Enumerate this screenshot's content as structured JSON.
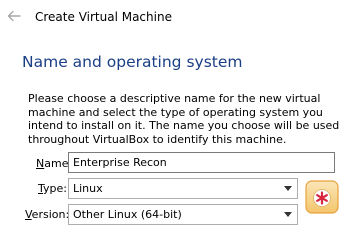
{
  "window": {
    "title": "Create Virtual Machine",
    "back_icon": "back-arrow-icon"
  },
  "page": {
    "heading": "Name and operating system",
    "description": "Please choose a descriptive name for the new virtual machine and select the type of operating system you intend to install on it. The name you choose will be used throughout VirtualBox to identify this machine."
  },
  "form": {
    "name": {
      "label_mnemonic": "N",
      "label_rest": "ame:",
      "value": "Enterprise Recon"
    },
    "type": {
      "label_mnemonic": "T",
      "label_rest": "ype:",
      "value": "Linux"
    },
    "version": {
      "label_mnemonic": "V",
      "label_rest": "ersion:",
      "value": "Other Linux (64-bit)"
    }
  },
  "os_icon": {
    "name": "other-linux-os-icon",
    "accent": "#e8a23c",
    "glyph_color": "#d7263d"
  }
}
